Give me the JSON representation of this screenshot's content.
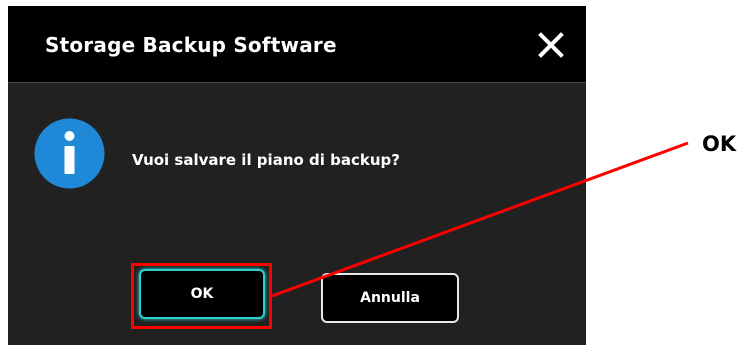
{
  "dialog": {
    "title": "Storage Backup Software",
    "close_icon": "close-icon",
    "info_icon": "info-icon",
    "message": "Vuoi salvare il piano di backup?",
    "ok_label": "OK",
    "cancel_label": "Annulla"
  },
  "annotation": {
    "label": "OK",
    "color": "#ff0000"
  },
  "colors": {
    "titlebar": "#000000",
    "body": "#212121",
    "accent_focus": "#2dd0cf",
    "info_blue": "#1f89d8"
  }
}
